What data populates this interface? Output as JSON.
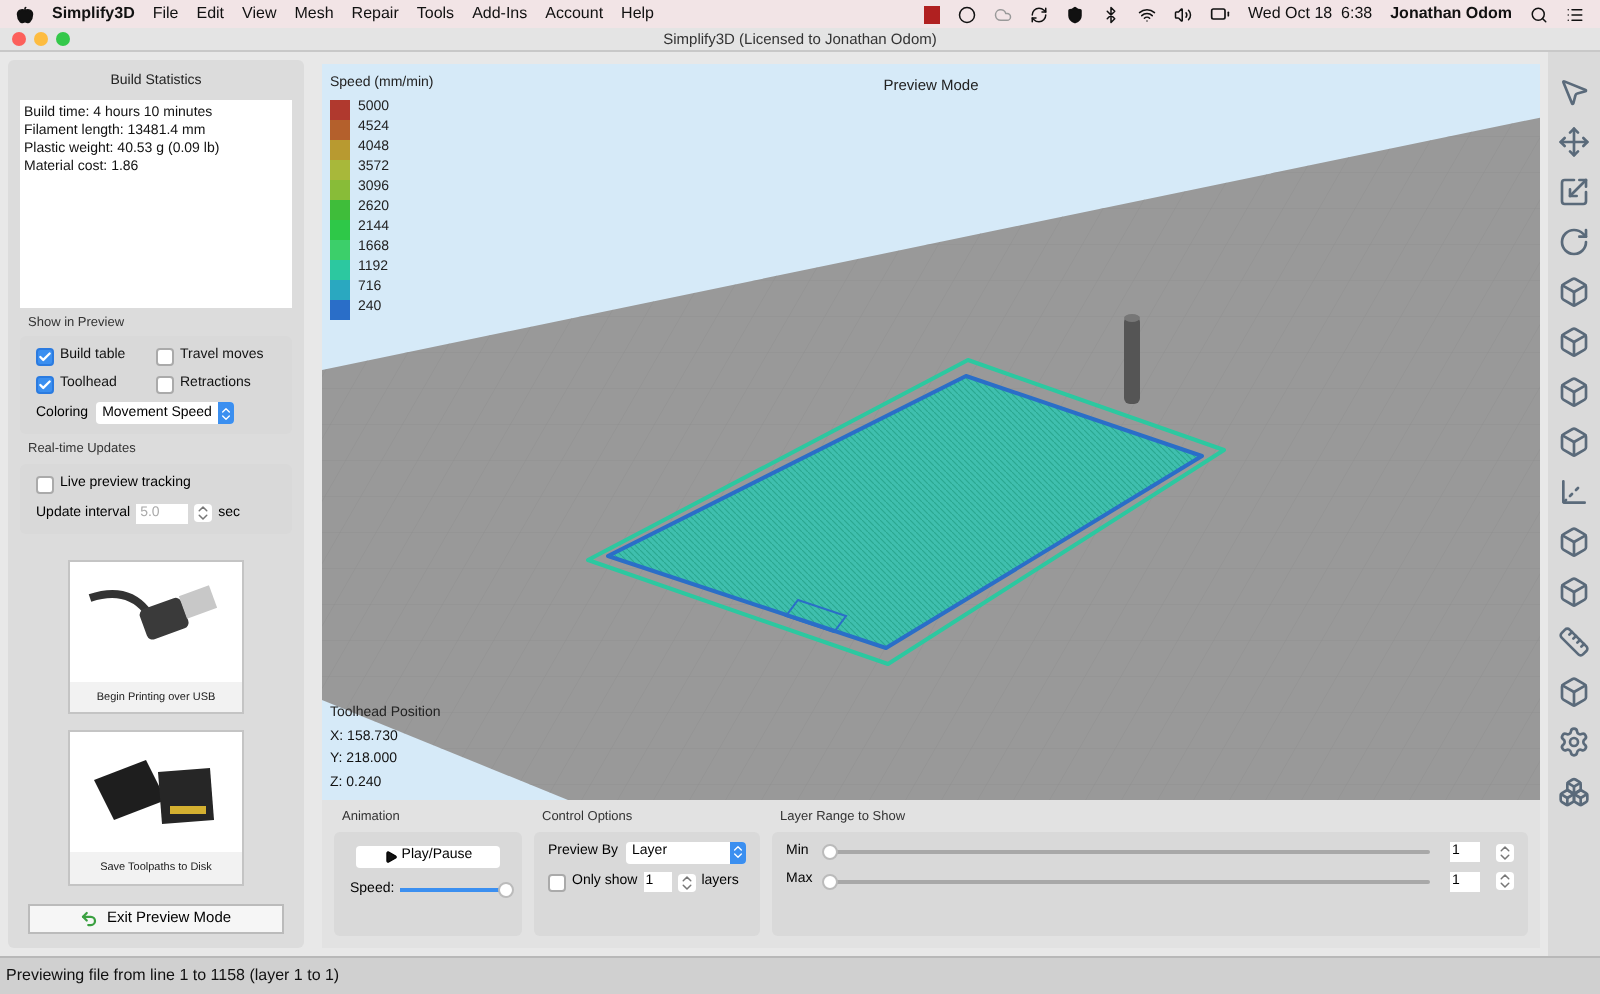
{
  "menu_bar": {
    "app_name": "Simplify3D",
    "menus": [
      "File",
      "Edit",
      "View",
      "Mesh",
      "Repair",
      "Tools",
      "Add-Ins",
      "Account",
      "Help"
    ],
    "clock": "Wed Oct 18  6:38",
    "user": "Jonathan Odom"
  },
  "window": {
    "title": "Simplify3D (Licensed to Jonathan Odom)"
  },
  "build_statistics": {
    "title": "Build Statistics",
    "lines": [
      "Build time: 4 hours 10 minutes",
      "Filament length: 13481.4 mm",
      "Plastic weight: 40.53 g (0.09 lb)",
      "Material cost: 1.86"
    ]
  },
  "show_in_preview": {
    "title": "Show in Preview",
    "options": [
      {
        "label": "Build table",
        "checked": true
      },
      {
        "label": "Travel moves",
        "checked": false
      },
      {
        "label": "Toolhead",
        "checked": true
      },
      {
        "label": "Retractions",
        "checked": false
      }
    ],
    "coloring": {
      "label": "Coloring",
      "value": "Movement Speed"
    }
  },
  "realtime_updates": {
    "title": "Real-time Updates",
    "live_tracking": {
      "label": "Live preview tracking",
      "checked": false
    },
    "update_interval": {
      "label": "Update interval",
      "value": "5.0",
      "unit": "sec",
      "disabled": true
    }
  },
  "actions": [
    {
      "kind": "usb",
      "label": "Begin Printing over USB"
    },
    {
      "kind": "sd",
      "label": "Save Toolpaths to Disk"
    }
  ],
  "exit_button": "Exit Preview Mode",
  "preview": {
    "title": "Preview Mode",
    "legend": {
      "title": "Speed (mm/min)",
      "items": [
        {
          "value": "5000",
          "color": "#b0392e"
        },
        {
          "value": "4524",
          "color": "#b4602c"
        },
        {
          "value": "4048",
          "color": "#b89a30"
        },
        {
          "value": "3572",
          "color": "#a8b83a"
        },
        {
          "value": "3096",
          "color": "#88bc38"
        },
        {
          "value": "2620",
          "color": "#3fbd3a"
        },
        {
          "value": "2144",
          "color": "#2ec848"
        },
        {
          "value": "1668",
          "color": "#3ccf6a"
        },
        {
          "value": "1192",
          "color": "#2cc8a0"
        },
        {
          "value": "716",
          "color": "#2aa8c0"
        },
        {
          "value": "240",
          "color": "#2a6ec8"
        }
      ]
    },
    "toolhead": {
      "title": "Toolhead Position",
      "lines": [
        "X: 158.730",
        "Y: 218.000",
        "Z: 0.240"
      ]
    }
  },
  "animation": {
    "title": "Animation",
    "button": "Play/Pause",
    "speed": {
      "label": "Speed:",
      "level": 1
    }
  },
  "control_options": {
    "title": "Control Options",
    "preview_by": {
      "label": "Preview By",
      "value": "Layer"
    },
    "only_show": {
      "label": "Only show",
      "checked": false,
      "value": "1",
      "unit": "layers"
    }
  },
  "layer_range": {
    "title": "Layer Range to Show",
    "rows": [
      {
        "label": "Min",
        "level": 0,
        "value": "1"
      },
      {
        "label": "Max",
        "level": 0,
        "value": "1"
      }
    ]
  },
  "status_bar": "Previewing file from line 1 to 1158 (layer 1 to 1)"
}
